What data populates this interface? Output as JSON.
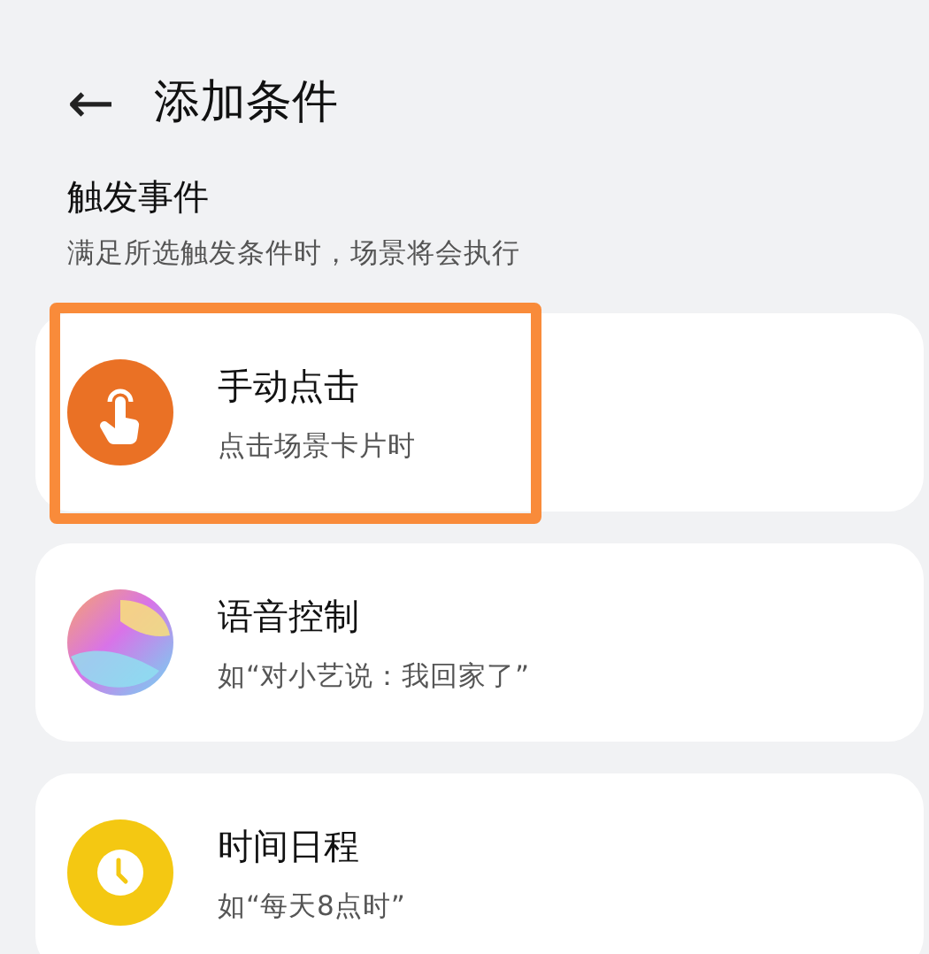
{
  "header": {
    "back_icon": "←",
    "title": "添加条件"
  },
  "section": {
    "title": "触发事件",
    "subtitle": "满足所选触发条件时，场景将会执行"
  },
  "items": [
    {
      "kind": "tap",
      "title": "手动点击",
      "subtitle": "点击场景卡片时",
      "highlighted": true
    },
    {
      "kind": "voice",
      "title": "语音控制",
      "subtitle": "如“对小艺说：我回家了”",
      "highlighted": false
    },
    {
      "kind": "clock",
      "title": "时间日程",
      "subtitle": "如“每天8点时”",
      "highlighted": false
    }
  ]
}
